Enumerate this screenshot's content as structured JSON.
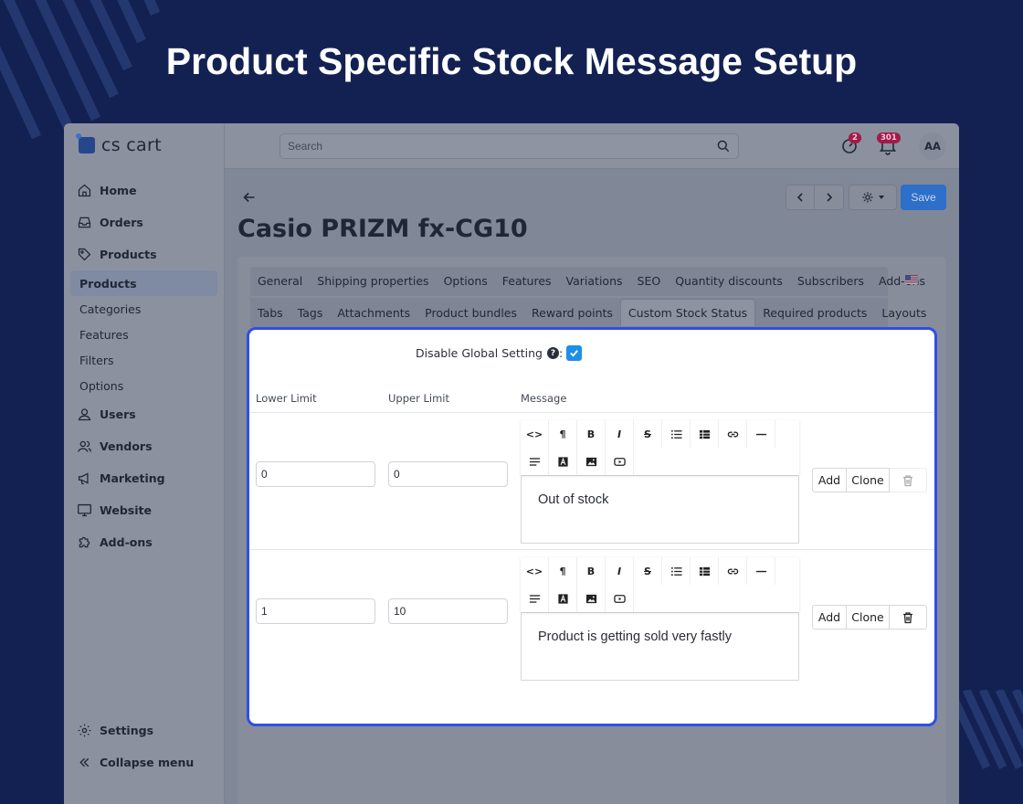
{
  "banner": {
    "title": "Product Specific Stock Message Setup"
  },
  "logo": {
    "text": "cs cart"
  },
  "search": {
    "placeholder": "Search"
  },
  "top_badges": {
    "help_count": "2",
    "notifications_count": "301"
  },
  "user": {
    "initials": "AA"
  },
  "sidebar": {
    "home": "Home",
    "orders": "Orders",
    "products": "Products",
    "products_sub": [
      "Products",
      "Categories",
      "Features",
      "Filters",
      "Options"
    ],
    "users": "Users",
    "vendors": "Vendors",
    "marketing": "Marketing",
    "website": "Website",
    "addons": "Add-ons",
    "settings": "Settings",
    "collapse": "Collapse menu"
  },
  "page": {
    "title": "Casio PRIZM fx-CG10",
    "save_label": "Save"
  },
  "tabs_row1": [
    "General",
    "Shipping properties",
    "Options",
    "Features",
    "Variations",
    "SEO",
    "Quantity discounts",
    "Subscribers",
    "Add-ons"
  ],
  "tabs_row2": [
    "Tabs",
    "Tags",
    "Attachments",
    "Product bundles",
    "Reward points",
    "Custom Stock Status",
    "Required products",
    "Layouts"
  ],
  "active_tab": "Custom Stock Status",
  "stock_status": {
    "disable_global_label": "Disable Global Setting",
    "disable_global_checked": true,
    "columns": {
      "lower": "Lower Limit",
      "upper": "Upper Limit",
      "message": "Message"
    },
    "rows": [
      {
        "lower": "0",
        "upper": "0",
        "message": "Out of stock"
      },
      {
        "lower": "1",
        "upper": "10",
        "message": "Product is getting sold very fastly"
      }
    ],
    "actions": {
      "add": "Add",
      "clone": "Clone"
    }
  },
  "editor_toolbar": [
    "code-view",
    "paragraph",
    "bold",
    "italic",
    "strikethrough",
    "unordered-list",
    "table",
    "link",
    "horizontal-rule",
    "align",
    "font-color",
    "image",
    "video"
  ],
  "colors": {
    "accent": "#2e4fe6",
    "save": "#2d6fc9",
    "checkbox": "#1f8fe6",
    "banner_bg": "#132152"
  }
}
